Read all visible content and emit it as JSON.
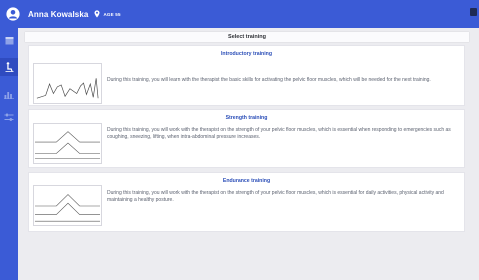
{
  "header": {
    "user_name": "Anna Kowalska",
    "age_tag": "AGE 55",
    "colors": {
      "bar": "#3b5bd6"
    }
  },
  "sidebar": {
    "items": [
      {
        "icon": "calendar-icon"
      },
      {
        "icon": "exercise-figure-icon",
        "active": true
      },
      {
        "icon": "bar-chart-icon"
      },
      {
        "icon": "equalizer-icon"
      }
    ]
  },
  "main": {
    "title": "Select training",
    "trainings": [
      {
        "title": "Introductory training",
        "description": "During this training, you will learn with the therapist the basic skills for activating the pelvic floor muscles, which will be needed for the next training.",
        "thumbnail_icon": "waveform-graph-icon"
      },
      {
        "title": "Strength training",
        "description": "During this training, you will work with the therapist on the strength of your pelvic floor muscles, which is essential when responding to emergencies such as coughing, sneezing, lifting, when intra-abdominal pressure increases.",
        "thumbnail_icon": "trapezoid-pattern-icon"
      },
      {
        "title": "Endurance training",
        "description": "During this training, you will work with the therapist on the strength of your pelvic floor muscles, which is essential for daily activities, physical activity and maintaining a healthy posture.",
        "thumbnail_icon": "trapezoid-pattern-icon"
      }
    ]
  }
}
